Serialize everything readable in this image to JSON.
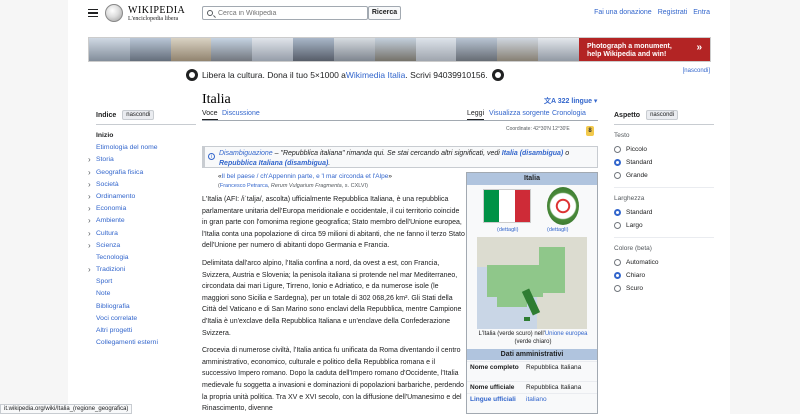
{
  "header": {
    "logo_text": "WIKIPEDIA",
    "logo_tagline": "L'enciclopedia libera",
    "search_placeholder": "Cerca in Wikipedia",
    "search_button": "Ricerca",
    "user_links": [
      "Fai una donazione",
      "Registrati",
      "Entra"
    ]
  },
  "banner": {
    "cta_text": "Photograph a monument, help Wikipedia and win!",
    "cta_chevron": "»"
  },
  "donate_line": {
    "prefix": "Libera la cultura. Dona il tuo 5×1000 a ",
    "link": "Wikimedia Italia",
    "suffix": ". Scrivi 94039910156."
  },
  "hide_link": "[nascondi]",
  "sidebar": {
    "heading": "Indice",
    "hide": "nascondi",
    "items": [
      "Inizio",
      "Etimologia del nome",
      "Storia",
      "Geografia fisica",
      "Società",
      "Ordinamento",
      "Economia",
      "Ambiente",
      "Cultura",
      "Scienza",
      "Tecnologia",
      "Tradizioni",
      "Sport",
      "Note",
      "Bibliografia",
      "Voci correlate",
      "Altri progetti",
      "Collegamenti esterni"
    ]
  },
  "article": {
    "title": "Italia",
    "languages": "322 lingue",
    "tabs": {
      "voce": "Voce",
      "discussione": "Discussione",
      "leggi": "Leggi",
      "visualizza_sorgente": "Visualizza sorgente",
      "cronologia": "Cronologia"
    },
    "coordinates": "Coordinate: 42°30′N 12°30′E",
    "lock_badge": "8",
    "hatnote": {
      "prefix": "Disambiguazione",
      "text": " – \"Repubblica italiana\" rimanda qui. Se stai cercando altri significati, vedi ",
      "link1": "Italia (disambigua)",
      "mid": " o ",
      "link2": "Repubblica Italiana (disambigua)",
      "end": "."
    },
    "quote": {
      "open": "«",
      "text": "Il bel paese / ch'Appennin parte, e 'l mar circonda et l'Alpe",
      "close": "»",
      "attribution_author": "Francesco Petrarca",
      "attribution_work": "Rerum Vulgarium Fragmenta",
      "attribution_rest": "s. CXLVI"
    },
    "paragraphs": [
      {
        "text": "L'Italia (AFI: /iˈtalja/, ascolta) ufficialmente Repubblica Italiana, è una repubblica parlamentare unitaria dell'Europa meridionale e occidentale, il cui territorio coincide in gran parte con l'omonima regione geografica; Stato membro dell'Unione europea, l'Italia conta una popolazione di circa 59 milioni di abitanti, che ne fanno il terzo Stato dell'Unione per numero di abitanti dopo Germania e Francia."
      },
      {
        "text": "Delimitata dall'arco alpino, l'Italia confina a nord, da ovest a est, con Francia, Svizzera, Austria e Slovenia; la penisola italiana si protende nel mar Mediterraneo, circondata dai mari Ligure, Tirreno, Ionio e Adriatico, e da numerose isole (le maggiori sono Sicilia e Sardegna), per un totale di 302 068,26 km². Gli Stati della Città del Vaticano e di San Marino sono enclavi della Repubblica, mentre Campione d'Italia è un'exclave della Repubblica Italiana e un'enclave della Confederazione Svizzera."
      },
      {
        "text": "Crocevia di numerose civiltà, l'Italia antica fu unificata da Roma diventando il centro amministrativo, economico, culturale e politico della Repubblica romana e il successivo Impero romano. Dopo la caduta dell'Impero romano d'Occidente, l'Italia medievale fu soggetta a invasioni e dominazioni di popolazioni barbariche, perdendo la propria unità politica. Tra XV e XVI secolo, con la diffusione dell'Umanesimo e del Rinascimento, divenne"
      }
    ]
  },
  "infobox": {
    "title": "Italia",
    "flag_link": "(dettagli)",
    "emblem_link": "(dettagli)",
    "map_caption_prefix": "L'Italia (verde scuro) nell'",
    "map_caption_link": "Unione europea",
    "map_caption_suffix": " (verde chiaro)",
    "section": "Dati amministrativi",
    "rows": [
      {
        "k": "Nome completo",
        "v": "Repubblica Italiana"
      },
      {
        "k": "Nome ufficiale",
        "v": "Repubblica Italiana"
      },
      {
        "k": "Lingue ufficiali",
        "v": "italiano"
      }
    ],
    "flag_colors": [
      "#009246",
      "#ffffff",
      "#ce2b37"
    ]
  },
  "appearance": {
    "heading": "Aspetto",
    "hide": "nascondi",
    "text_label": "Testo",
    "text_options": [
      "Piccolo",
      "Standard",
      "Grande"
    ],
    "text_selected": 1,
    "width_label": "Larghezza",
    "width_options": [
      "Standard",
      "Largo"
    ],
    "width_selected": 0,
    "color_label": "Colore (beta)",
    "color_options": [
      "Automatico",
      "Chiaro",
      "Scuro"
    ],
    "color_selected": 1
  },
  "statusbar": "it.wikipedia.org/wiki/Italia_(regione_geografica)"
}
